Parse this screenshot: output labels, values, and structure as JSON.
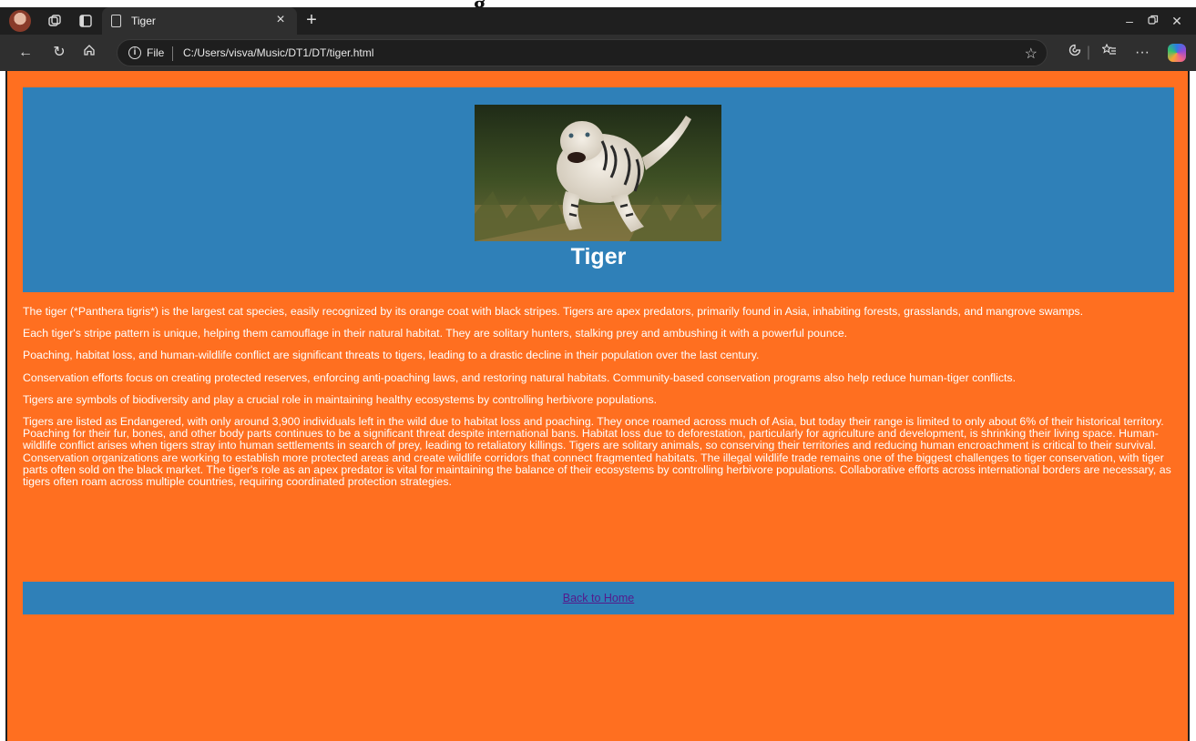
{
  "browser": {
    "tab": {
      "title": "Tiger"
    },
    "address": {
      "scheme_label": "File",
      "url": "C:/Users/visva/Music/DT1/DT/tiger.html"
    },
    "icons": {
      "profile": "avatar",
      "workspaces": "workspaces-icon",
      "vertical_tabs": "tab-actions-icon",
      "tab_page": "page-icon",
      "close_tab": "close-icon",
      "new_tab": "plus-icon",
      "back": "back-arrow-icon",
      "refresh": "refresh-icon",
      "home": "home-icon",
      "info": "info-icon",
      "favorite": "star-icon",
      "extensions": "extensions-icon",
      "favorites": "favorites-icon",
      "more": "more-icon",
      "copilot": "copilot-icon",
      "minimize": "minimize-icon",
      "restore": "restore-icon",
      "close_window": "close-window-icon"
    }
  },
  "page": {
    "title": "Tiger",
    "hero_image_alt": "tiger",
    "paragraphs": [
      "The tiger (*Panthera tigris*) is the largest cat species, easily recognized by its orange coat with black stripes. Tigers are apex predators, primarily found in Asia, inhabiting forests, grasslands, and mangrove swamps.",
      "Each tiger's stripe pattern is unique, helping them camouflage in their natural habitat. They are solitary hunters, stalking prey and ambushing it with a powerful pounce.",
      "Poaching, habitat loss, and human-wildlife conflict are significant threats to tigers, leading to a drastic decline in their population over the last century.",
      "Conservation efforts focus on creating protected reserves, enforcing anti-poaching laws, and restoring natural habitats. Community-based conservation programs also help reduce human-tiger conflicts.",
      "Tigers are symbols of biodiversity and play a crucial role in maintaining healthy ecosystems by controlling herbivore populations.",
      "Tigers are listed as Endangered, with only around 3,900 individuals left in the wild due to habitat loss and poaching. They once roamed across much of Asia, but today their range is limited to only about 6% of their historical territory. Poaching for their fur, bones, and other body parts continues to be a significant threat despite international bans. Habitat loss due to deforestation, particularly for agriculture and development, is shrinking their living space. Human-wildlife conflict arises when tigers stray into human settlements in search of prey, leading to retaliatory killings. Tigers are solitary animals, so conserving their territories and reducing human encroachment is critical to their survival. Conservation organizations are working to establish more protected areas and create wildlife corridors that connect fragmented habitats. The illegal wildlife trade remains one of the biggest challenges to tiger conservation, with tiger parts often sold on the black market. The tiger's role as an apex predator is vital for maintaining the balance of their ecosystems by controlling herbivore populations. Collaborative efforts across international borders are necessary, as tigers often roam across multiple countries, requiring coordinated protection strategies."
    ],
    "back_link": "Back to Home"
  },
  "colors": {
    "page_background": "#ff6f20",
    "panel_blue": "#2f80b8",
    "text": "#ffffff",
    "link_visited": "#551a8b",
    "browser_chrome": "#2f2f2f"
  }
}
